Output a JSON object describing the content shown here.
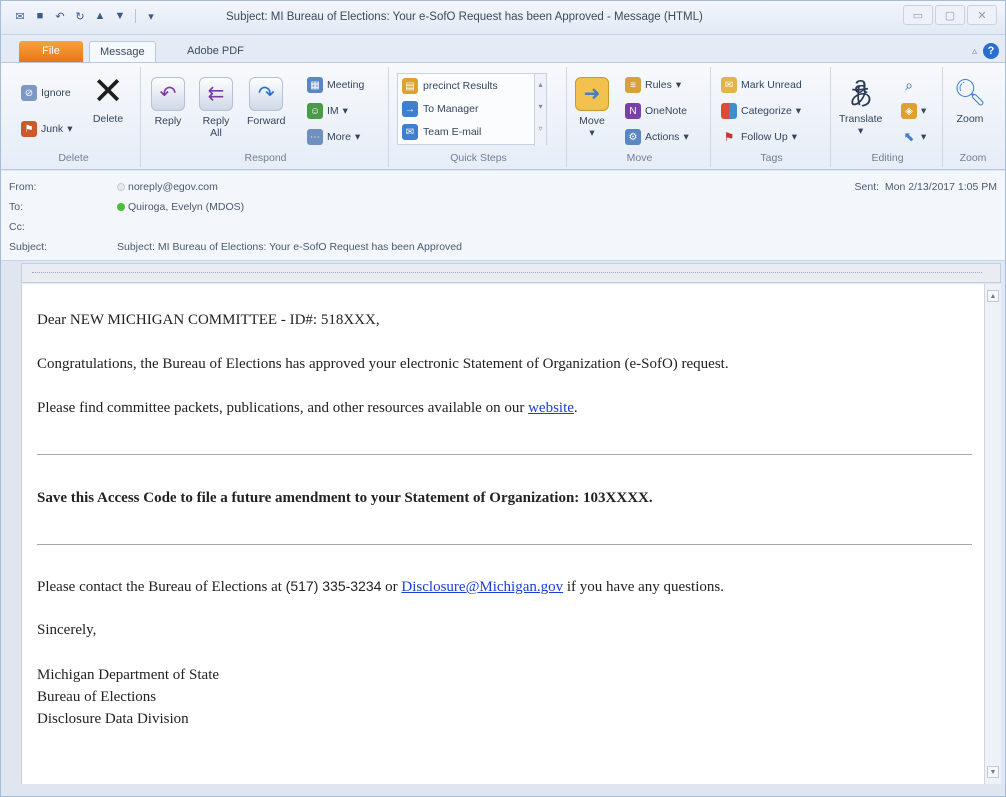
{
  "window": {
    "title": "Subject: MI Bureau of Elections: Your e-SofO Request has been Approved  -  Message (HTML)"
  },
  "tabs": {
    "file": "File",
    "message": "Message",
    "adobe": "Adobe PDF"
  },
  "ribbon": {
    "delete_group": {
      "label": "Delete",
      "ignore": "Ignore",
      "junk": "Junk",
      "delete": "Delete"
    },
    "respond_group": {
      "label": "Respond",
      "reply": "Reply",
      "reply_all_1": "Reply",
      "reply_all_2": "All",
      "forward": "Forward",
      "meeting": "Meeting",
      "im": "IM",
      "more": "More"
    },
    "quick_steps_group": {
      "label": "Quick Steps",
      "items": [
        "precinct Results",
        "To Manager",
        "Team E-mail"
      ]
    },
    "move_group": {
      "label": "Move",
      "move": "Move",
      "rules": "Rules",
      "onenote": "OneNote",
      "actions": "Actions"
    },
    "tags_group": {
      "label": "Tags",
      "mark_unread": "Mark Unread",
      "categorize": "Categorize",
      "follow_up": "Follow Up"
    },
    "editing_group": {
      "label": "Editing",
      "translate": "Translate"
    },
    "zoom_group": {
      "label": "Zoom",
      "zoom": "Zoom"
    }
  },
  "header": {
    "from_label": "From:",
    "from_value": "noreply@egov.com",
    "to_label": "To:",
    "to_value": "Quiroga, Evelyn (MDOS)",
    "cc_label": "Cc:",
    "subject_label": "Subject:",
    "subject_value": "Subject: MI Bureau of Elections: Your e-SofO Request has been Approved",
    "sent_label": "Sent:",
    "sent_value": "Mon 2/13/2017 1:05 PM"
  },
  "body": {
    "greeting": "Dear NEW MICHIGAN COMMITTEE - ID#: 518XXX,",
    "congrats": "Congratulations, the Bureau of Elections has approved your electronic Statement of Organization (e-SofO) request.",
    "resources_prefix": "Please find committee packets, publications, and other resources available on our ",
    "resources_link": "website",
    "resources_suffix": ".",
    "access_code": "Save this Access Code to file a future amendment to your Statement of Organization: 103XXXX.",
    "contact_prefix": "Please contact the Bureau of Elections at ",
    "contact_phone": "(517) 335-3234",
    "contact_or": " or ",
    "contact_email": "Disclosure@Michigan.gov",
    "contact_suffix": " if you have any questions.",
    "closing": "Sincerely,",
    "sig_line1": "Michigan Department of State",
    "sig_line2": "Bureau of Elections",
    "sig_line3": "Disclosure Data Division"
  },
  "colors": {
    "file_tab": "#e8761a",
    "link": "#1a3fd6",
    "accent": "#2a6fd0"
  }
}
